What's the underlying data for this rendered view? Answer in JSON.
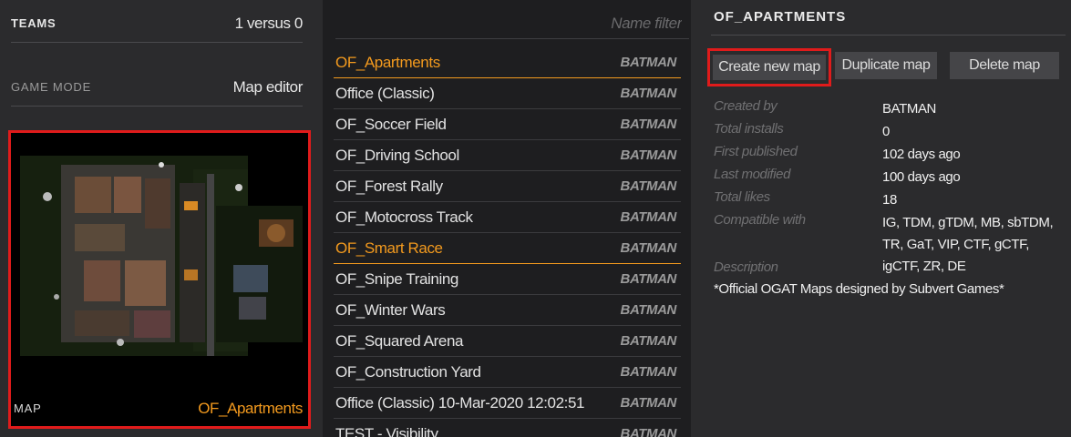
{
  "settings": {
    "teams_label": "TEAMS",
    "teams_value": "1 versus 0",
    "game_mode_label": "GAME MODE",
    "game_mode_value": "Map editor",
    "map_label": "MAP",
    "map_value": "OF_Apartments"
  },
  "list": {
    "filter_placeholder": "Name filter",
    "items": [
      {
        "name": "OF_Apartments",
        "author": "BATMAN",
        "highlighted": true
      },
      {
        "name": "Office (Classic)",
        "author": "BATMAN"
      },
      {
        "name": "OF_Soccer Field",
        "author": "BATMAN"
      },
      {
        "name": "OF_Driving School",
        "author": "BATMAN"
      },
      {
        "name": "OF_Forest Rally",
        "author": "BATMAN"
      },
      {
        "name": "OF_Motocross Track",
        "author": "BATMAN"
      },
      {
        "name": "OF_Smart Race",
        "author": "BATMAN",
        "highlighted": true
      },
      {
        "name": "OF_Snipe Training",
        "author": "BATMAN"
      },
      {
        "name": "OF_Winter Wars",
        "author": "BATMAN"
      },
      {
        "name": "OF_Squared Arena",
        "author": "BATMAN"
      },
      {
        "name": "OF_Construction Yard",
        "author": "BATMAN"
      },
      {
        "name": "Office (Classic) 10-Mar-2020 12:02:51",
        "author": "BATMAN"
      },
      {
        "name": "TEST - Visibility",
        "author": "BATMAN"
      }
    ]
  },
  "details": {
    "title": "OF_APARTMENTS",
    "buttons": {
      "create": "Create new map",
      "duplicate": "Duplicate map",
      "delete": "Delete map"
    },
    "created_by_label": "Created by",
    "created_by": "BATMAN",
    "total_installs_label": "Total installs",
    "total_installs": "0",
    "first_published_label": "First published",
    "first_published": "102 days ago",
    "last_modified_label": "Last modified",
    "last_modified": "100 days ago",
    "total_likes_label": "Total likes",
    "total_likes": "18",
    "compatible_label": "Compatible with",
    "compatible": "IG, TDM, gTDM, MB, sbTDM, TR, GaT, VIP, CTF, gCTF, igCTF, ZR, DE",
    "description_label": "Description",
    "description": "*Official OGAT Maps designed by Subvert Games*"
  },
  "colors": {
    "accent": "#f39a1e",
    "highlight_border": "#e01b1b"
  }
}
